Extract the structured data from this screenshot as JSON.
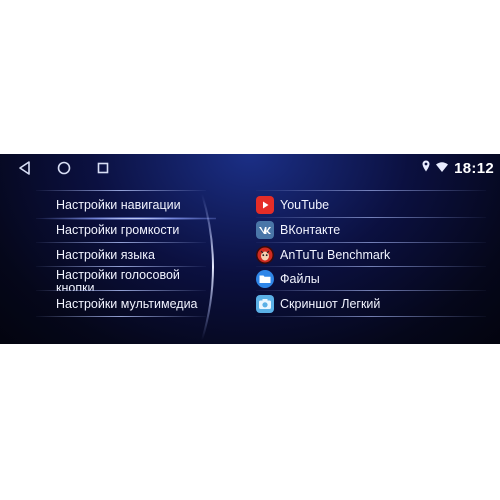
{
  "status": {
    "time": "18:12",
    "icons": [
      "location-icon",
      "wifi-icon"
    ]
  },
  "nav_buttons": [
    "back-icon",
    "home-icon",
    "recents-icon"
  ],
  "settings_menu": {
    "items": [
      {
        "label": "Настройки навигации"
      },
      {
        "label": "Настройки громкости"
      },
      {
        "label": "Настройки языка"
      },
      {
        "label": "Настройки голосовой кнопки"
      },
      {
        "label": "Настройки мультимедиа"
      }
    ],
    "selected_index": 0
  },
  "apps": [
    {
      "label": "YouTube",
      "icon": "youtube-icon",
      "color": "#e52d27"
    },
    {
      "label": "ВКонтакте",
      "icon": "vk-icon",
      "color": "#4a76a8"
    },
    {
      "label": "AnTuTu Benchmark",
      "icon": "antutu-icon",
      "color": "#d02b20"
    },
    {
      "label": "Файлы",
      "icon": "files-icon",
      "color": "#2f86e8"
    },
    {
      "label": "Скриншот Легкий",
      "icon": "screenshot-icon",
      "color": "#5ab0e6"
    }
  ],
  "colors": {
    "accent_glow": "#7f94ff",
    "background_top": "#1b2f86",
    "background_bottom": "#03040f"
  }
}
